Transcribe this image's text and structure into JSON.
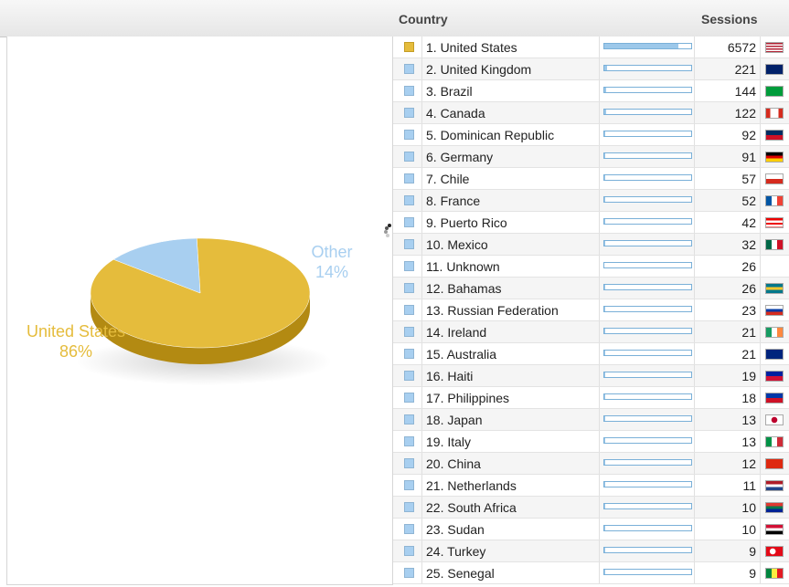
{
  "header": {
    "country_label": "Country",
    "sessions_label": "Sessions"
  },
  "pie": {
    "slices": [
      {
        "label": "United States",
        "percent_label": "86%",
        "value": 86,
        "color": "#e5bc3c",
        "side_color": "#b38a12"
      },
      {
        "label": "Other",
        "percent_label": "14%",
        "value": 14,
        "color": "#a8cff0",
        "side_color": "#7fa7c8"
      }
    ]
  },
  "rows": [
    {
      "label": "1. United States",
      "sessions": "6572",
      "bar": 0.85,
      "selected": true,
      "flag": "us"
    },
    {
      "label": "2. United Kingdom",
      "sessions": "221",
      "bar": 0.03,
      "flag": "uk"
    },
    {
      "label": "3. Brazil",
      "sessions": "144",
      "bar": 0.02,
      "flag": "br"
    },
    {
      "label": "4. Canada",
      "sessions": "122",
      "bar": 0.02,
      "flag": "ca"
    },
    {
      "label": "5. Dominican Republic",
      "sessions": "92",
      "bar": 0.01,
      "flag": "do"
    },
    {
      "label": "6. Germany",
      "sessions": "91",
      "bar": 0.01,
      "flag": "de"
    },
    {
      "label": "7. Chile",
      "sessions": "57",
      "bar": 0.01,
      "flag": "cl"
    },
    {
      "label": "8. France",
      "sessions": "52",
      "bar": 0.01,
      "flag": "fr"
    },
    {
      "label": "9. Puerto Rico",
      "sessions": "42",
      "bar": 0.01,
      "flag": "pr"
    },
    {
      "label": "10. Mexico",
      "sessions": "32",
      "bar": 0.005,
      "flag": "mx"
    },
    {
      "label": "11. Unknown",
      "sessions": "26",
      "bar": 0.0,
      "flag": ""
    },
    {
      "label": "12. Bahamas",
      "sessions": "26",
      "bar": 0.004,
      "flag": "bs"
    },
    {
      "label": "13. Russian Federation",
      "sessions": "23",
      "bar": 0.004,
      "flag": "ru"
    },
    {
      "label": "14. Ireland",
      "sessions": "21",
      "bar": 0.003,
      "flag": "ie"
    },
    {
      "label": "15. Australia",
      "sessions": "21",
      "bar": 0.003,
      "flag": "au"
    },
    {
      "label": "16. Haiti",
      "sessions": "19",
      "bar": 0.003,
      "flag": "ht"
    },
    {
      "label": "17. Philippines",
      "sessions": "18",
      "bar": 0.003,
      "flag": "ph"
    },
    {
      "label": "18. Japan",
      "sessions": "13",
      "bar": 0.002,
      "flag": "jp"
    },
    {
      "label": "19. Italy",
      "sessions": "13",
      "bar": 0.002,
      "flag": "it"
    },
    {
      "label": "20. China",
      "sessions": "12",
      "bar": 0.002,
      "flag": "cn"
    },
    {
      "label": "21. Netherlands",
      "sessions": "11",
      "bar": 0.002,
      "flag": "nl"
    },
    {
      "label": "22. South Africa",
      "sessions": "10",
      "bar": 0.002,
      "flag": "za"
    },
    {
      "label": "23. Sudan",
      "sessions": "10",
      "bar": 0.002,
      "flag": "sd"
    },
    {
      "label": "24. Turkey",
      "sessions": "9",
      "bar": 0.001,
      "flag": "tr"
    },
    {
      "label": "25. Senegal",
      "sessions": "9",
      "bar": 0.001,
      "flag": "sn"
    }
  ]
}
